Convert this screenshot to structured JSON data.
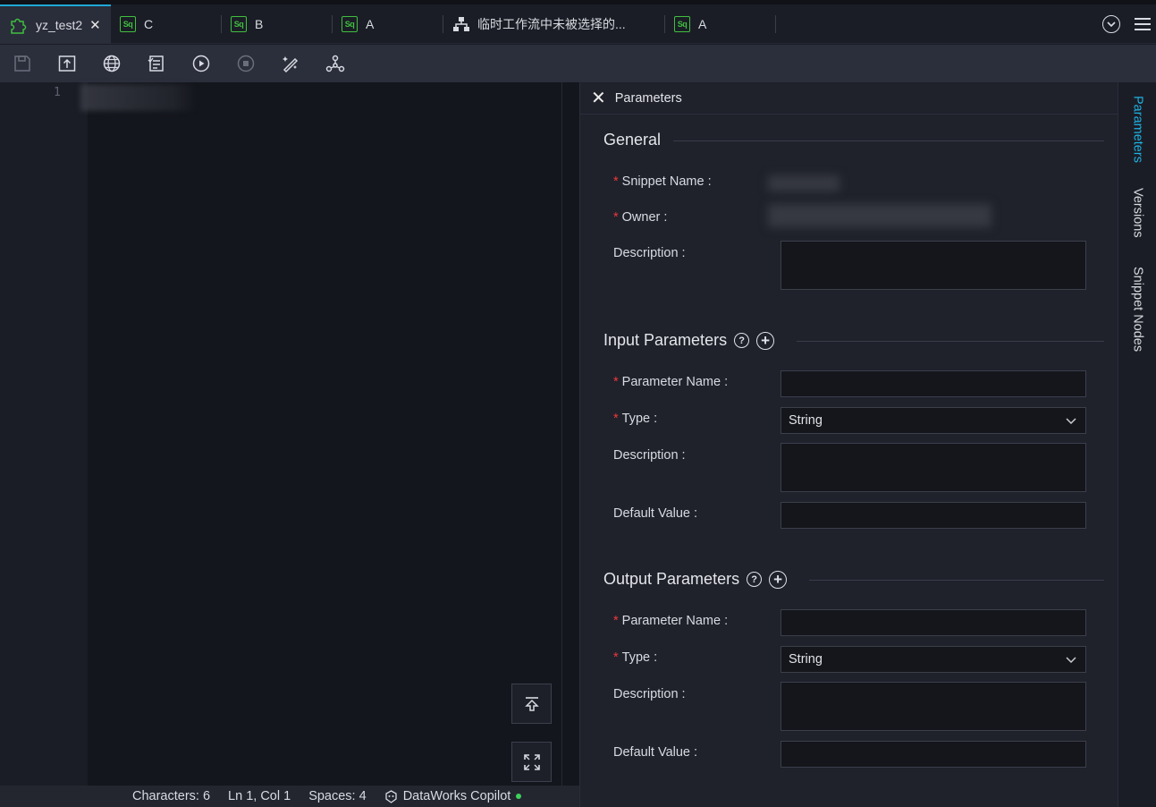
{
  "tabs": [
    {
      "label": "yz_test2",
      "icon": "puzzle-icon",
      "active": true,
      "closable": true
    },
    {
      "label": "C",
      "icon": "sql-icon"
    },
    {
      "label": "B",
      "icon": "sql-icon"
    },
    {
      "label": "A",
      "icon": "sql-icon"
    },
    {
      "label": "临时工作流中未被选择的...",
      "icon": "workflow-icon"
    },
    {
      "label": "A",
      "icon": "sql-icon"
    }
  ],
  "sql_icon_text": "Sq",
  "toolbar": {
    "icons": [
      "save-icon",
      "submit-icon",
      "globe-icon",
      "checklist-icon",
      "run-icon",
      "stop-icon",
      "format-icon",
      "lineage-icon"
    ]
  },
  "editor": {
    "line_number": "1"
  },
  "status": {
    "characters": "Characters: 6",
    "position": "Ln 1, Col 1",
    "spaces": "Spaces: 4",
    "copilot": "DataWorks Copilot"
  },
  "panel": {
    "title": "Parameters",
    "general": {
      "heading": "General",
      "snippet_name_label": "Snippet Name :",
      "owner_label": "Owner :",
      "description_label": "Description :"
    },
    "input": {
      "heading": "Input Parameters",
      "param_name_label": "Parameter Name :",
      "type_label": "Type :",
      "type_value": "String",
      "description_label": "Description :",
      "default_label": "Default Value :"
    },
    "output": {
      "heading": "Output Parameters",
      "param_name_label": "Parameter Name :",
      "type_label": "Type :",
      "type_value": "String",
      "description_label": "Description :",
      "default_label": "Default Value :"
    },
    "required_mark": "*",
    "help_mark": "?",
    "add_mark": "+"
  },
  "side_tabs": [
    {
      "label": "Parameters",
      "active": true
    },
    {
      "label": "Versions"
    },
    {
      "label": "Snippet Nodes"
    }
  ],
  "colors": {
    "accent": "#1fa8d6",
    "sql_green": "#3fbf3f",
    "required_red": "#ec3a3a",
    "status_green": "#3dd15a"
  }
}
